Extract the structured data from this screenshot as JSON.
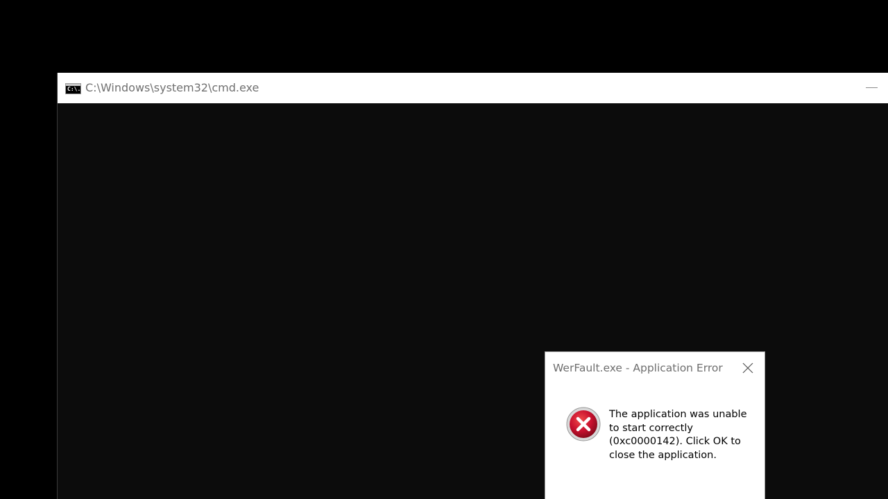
{
  "cmd_window": {
    "title": "C:\\Windows\\system32\\cmd.exe",
    "icon_text": "C:\\.",
    "icon": "cmd-icon",
    "minimize_icon": "minimize-icon"
  },
  "error_dialog": {
    "title": "WerFault.exe - Application Error",
    "message": "The application was unable to start correctly (0xc0000142). Click OK to close the application.",
    "icon": "error-icon",
    "close_icon": "close-icon",
    "colors": {
      "error_red": "#c8102e",
      "error_ring": "#d9d9d9"
    }
  },
  "colors": {
    "desktop": "#000000",
    "console_bg": "#0c0c0c",
    "titlebar_bg": "#ffffff",
    "title_text": "#707070"
  }
}
